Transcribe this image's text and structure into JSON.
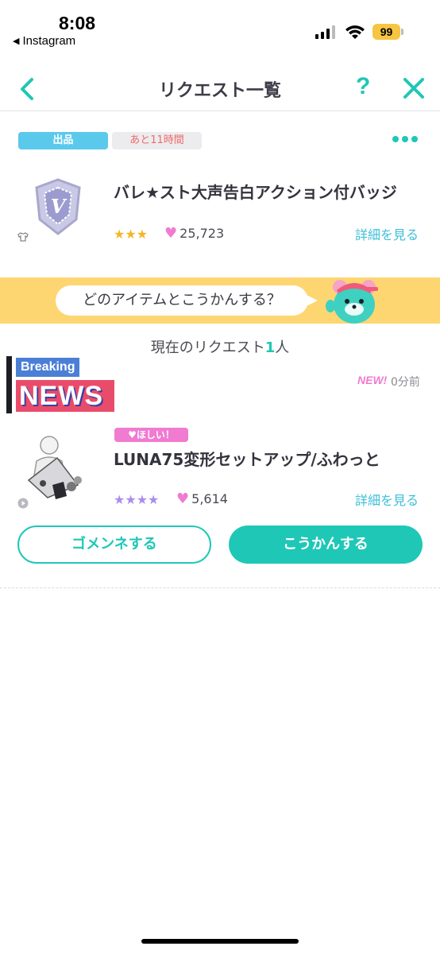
{
  "status_bar": {
    "time": "8:08",
    "back_app": "Instagram",
    "battery": "99"
  },
  "header": {
    "title": "リクエスト一覧",
    "help": "?"
  },
  "tags": {
    "sell": "出品",
    "remaining": "あと11時間"
  },
  "listed_item": {
    "title": "バレ★スト大声告白アクション付バッジ",
    "stars": "★★★",
    "likes": "25,723",
    "detail_link": "詳細を見る"
  },
  "banner": {
    "text": "どのアイテムとこうかんする？"
  },
  "request_count": {
    "prefix": "現在のリクエスト",
    "number": "1",
    "suffix": "人"
  },
  "overlay": {
    "breaking": "Breaking",
    "news": "NEWS"
  },
  "request": {
    "new_badge": "NEW!",
    "time_ago": "0分前",
    "want_tag": "ほしい！",
    "title": "LUNA75変形セットアップ/ふわっと",
    "stars": "★★★★",
    "likes": "5,614",
    "detail_link": "詳細を見る"
  },
  "actions": {
    "decline": "ゴメンネする",
    "exchange": "こうかんする"
  },
  "colors": {
    "accent": "#1fc7b6",
    "link": "#3dbfd8",
    "pink": "#f07bd0",
    "banner": "#fdd672"
  }
}
